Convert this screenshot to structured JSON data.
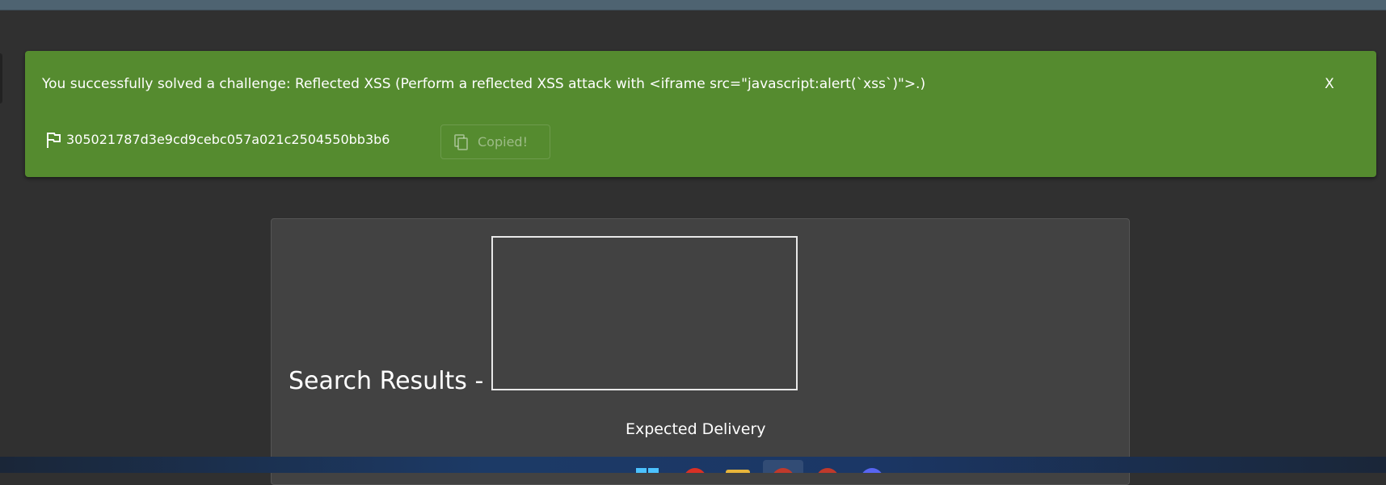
{
  "banner": {
    "message": "You successfully solved a challenge: Reflected XSS (Perform a reflected XSS attack with <iframe src=\"javascript:alert(`xss`)\">.)",
    "close_label": "X",
    "flag_icon": "flag-icon",
    "flag_value": "305021787d3e9cd9cebc057a021c2504550bb3b6",
    "copy_icon": "copy-icon",
    "copy_label": "Copied!",
    "color": "#558b2f"
  },
  "main": {
    "search_heading": "Search Results -",
    "column_header": "Expected Delivery"
  },
  "taskbar": {
    "icons": [
      "windows-start-icon",
      "chrome-icon",
      "file-explorer-icon",
      "active-app-icon",
      "browser-icon",
      "app-icon"
    ]
  }
}
